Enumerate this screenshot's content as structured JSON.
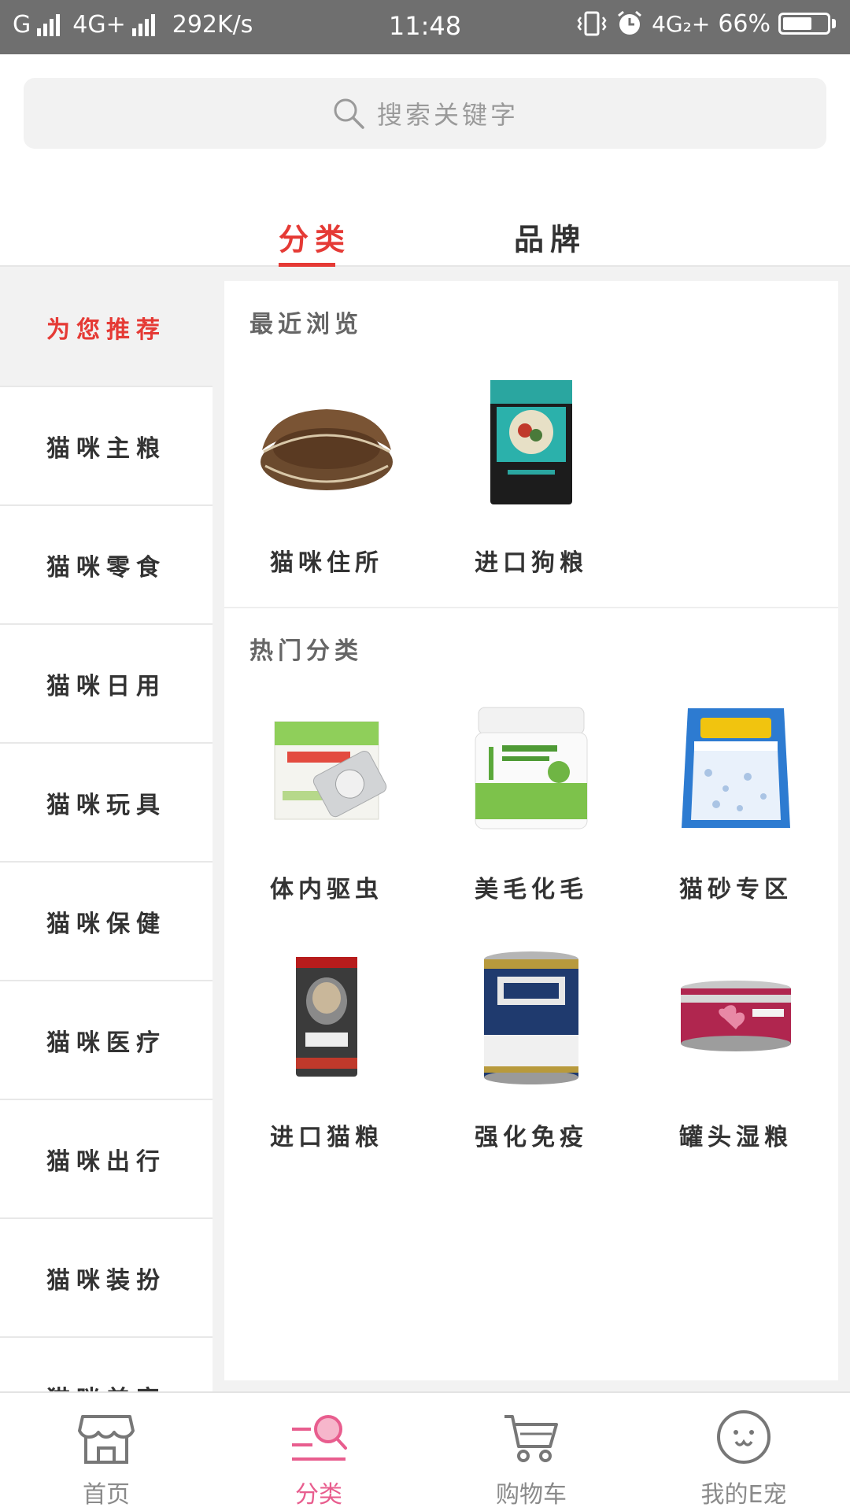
{
  "status_bar": {
    "carrier1": "G",
    "carrier2": "4G+",
    "speed": "292K/s",
    "time": "11:48",
    "network": "4G₂+",
    "battery": "66%",
    "battery_level": 0.66
  },
  "search": {
    "placeholder": "搜索关键字"
  },
  "tabs": [
    {
      "label": "分类",
      "active": true
    },
    {
      "label": "品牌",
      "active": false
    }
  ],
  "sidebar": {
    "items": [
      {
        "label": "为您推荐",
        "active": true
      },
      {
        "label": "猫咪主粮"
      },
      {
        "label": "猫咪零食"
      },
      {
        "label": "猫咪日用"
      },
      {
        "label": "猫咪玩具"
      },
      {
        "label": "猫咪保健"
      },
      {
        "label": "猫咪医疗"
      },
      {
        "label": "猫咪出行"
      },
      {
        "label": "猫咪装扮"
      },
      {
        "label": "猫咪美容"
      }
    ]
  },
  "recent": {
    "title": "最近浏览",
    "items": [
      {
        "label": "猫咪住所",
        "icon": "cat-bed-image"
      },
      {
        "label": "进口狗粮",
        "icon": "dog-food-bag-image"
      }
    ]
  },
  "hot": {
    "title": "热门分类",
    "items": [
      {
        "label": "体内驱虫",
        "icon": "deworming-pill-image"
      },
      {
        "label": "美毛化毛",
        "icon": "supplement-jar-image"
      },
      {
        "label": "猫砂专区",
        "icon": "cat-litter-bag-image"
      },
      {
        "label": "进口猫粮",
        "icon": "cat-food-bag-image"
      },
      {
        "label": "强化免疫",
        "icon": "milk-powder-can-image"
      },
      {
        "label": "罐头湿粮",
        "icon": "canned-food-image"
      }
    ]
  },
  "bottom_nav": {
    "items": [
      {
        "label": "首页",
        "icon": "store-icon"
      },
      {
        "label": "分类",
        "icon": "category-search-icon",
        "active": true
      },
      {
        "label": "购物车",
        "icon": "cart-icon"
      },
      {
        "label": "我的E宠",
        "icon": "smiley-profile-icon"
      }
    ]
  },
  "colors": {
    "accent": "#e53a35",
    "nav_active": "#e85d8e",
    "status_bar": "#6f6f6f"
  }
}
